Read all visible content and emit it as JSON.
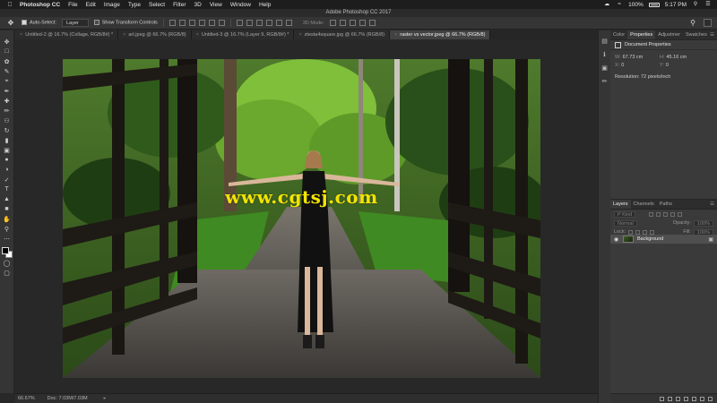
{
  "menubar": {
    "app": "Photoshop CC",
    "items": [
      "File",
      "Edit",
      "Image",
      "Type",
      "Select",
      "Filter",
      "3D",
      "View",
      "Window",
      "Help"
    ],
    "battery": "100%",
    "clock": "5:17 PM",
    "icons": [
      "apple-icon",
      "creative-cloud-icon",
      "wifi-icon",
      "battery-icon",
      "search-icon",
      "list-icon"
    ]
  },
  "window_title": "Adobe Photoshop CC 2017",
  "options": {
    "auto_select_label": "Auto-Select:",
    "auto_select_checked": true,
    "auto_select_value": "Layer",
    "show_transform_label": "Show Transform Controls",
    "show_transform_checked": false,
    "mode_3d_label": "3D Mode:"
  },
  "tabs": [
    {
      "label": "Untitled-2 @ 16.7% (Collage, RGB/8#) *",
      "active": false
    },
    {
      "label": "art.jpeg @ 66.7% (RGB/8)",
      "active": false
    },
    {
      "label": "Untitled-3 @ 16.7% (Layer 9, RGB/8#) *",
      "active": false
    },
    {
      "label": "ztesta4square.jpg @ 66.7% (RGB/8)",
      "active": false
    },
    {
      "label": "raster vs vector.jpeg @ 66.7% (RGB/8)",
      "active": true
    }
  ],
  "watermark": "www.cgtsj.com",
  "status": {
    "zoom": "66.67%",
    "doc": "Doc: 7.03M/7.03M"
  },
  "properties_panel": {
    "tabs": [
      "Color",
      "Properties",
      "Adjustmer",
      "Swatches"
    ],
    "active_tab": "Properties",
    "header": "Document Properties",
    "w_label": "W:",
    "w_value": "67.73 cm",
    "h_label": "H:",
    "h_value": "45.16 cm",
    "x_label": "X:",
    "x_value": "0",
    "y_label": "Y:",
    "y_value": "0",
    "resolution": "Resolution: 72 pixels/inch"
  },
  "layers_panel": {
    "tabs": [
      "Layers",
      "Channels",
      "Paths"
    ],
    "active_tab": "Layers",
    "filter_kind": "P Kind",
    "blend_mode": "Normal",
    "opacity_label": "Opacity:",
    "opacity_value": "100%",
    "lock_label": "Lock:",
    "fill_label": "Fill:",
    "fill_value": "100%",
    "layers": [
      {
        "name": "Background",
        "visible": true,
        "locked": true
      }
    ]
  },
  "colors": {
    "accent_watermark": "#f2e400",
    "panel_bg": "#3a3a3a",
    "canvas_bg": "#282828"
  }
}
